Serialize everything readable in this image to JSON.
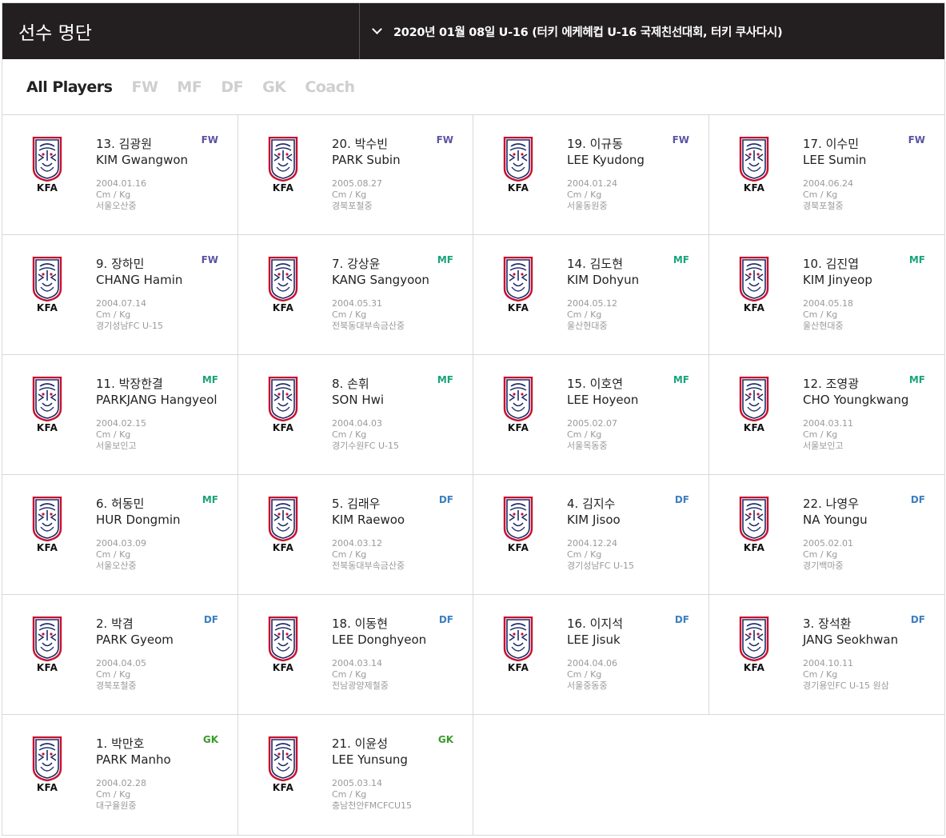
{
  "header": {
    "title": "선수 명단",
    "selector": "2020년 01월 08일 U-16 (터키 에케헤컵 U-16 국제친선대회, 터키 쿠사다시)"
  },
  "filters": [
    "All Players",
    "FW",
    "MF",
    "DF",
    "GK",
    "Coach"
  ],
  "active_filter": "All Players",
  "logo_text": "KFA",
  "position_colors": {
    "FW": "#5b54a3",
    "MF": "#1aa47a",
    "DF": "#3d7fc0",
    "GK": "#3a9a2a"
  },
  "players": [
    {
      "kname": "13. 김광원",
      "ename": "KIM Gwangwon",
      "pos": "FW",
      "birth": "2004.01.16",
      "size": "Cm / Kg",
      "team": "서울오산중"
    },
    {
      "kname": "20. 박수빈",
      "ename": "PARK Subin",
      "pos": "FW",
      "birth": "2005.08.27",
      "size": "Cm / Kg",
      "team": "경북포철중"
    },
    {
      "kname": "19. 이규동",
      "ename": "LEE Kyudong",
      "pos": "FW",
      "birth": "2004.01.24",
      "size": "Cm / Kg",
      "team": "서울동원중"
    },
    {
      "kname": "17. 이수민",
      "ename": "LEE Sumin",
      "pos": "FW",
      "birth": "2004.06.24",
      "size": "Cm / Kg",
      "team": "경북포철중"
    },
    {
      "kname": "9. 장하민",
      "ename": "CHANG Hamin",
      "pos": "FW",
      "birth": "2004.07.14",
      "size": "Cm / Kg",
      "team": "경기성남FC U-15"
    },
    {
      "kname": "7. 강상윤",
      "ename": "KANG Sangyoon",
      "pos": "MF",
      "birth": "2004.05.31",
      "size": "Cm / Kg",
      "team": "전북동대부속금산중"
    },
    {
      "kname": "14. 김도현",
      "ename": "KIM Dohyun",
      "pos": "MF",
      "birth": "2004.05.12",
      "size": "Cm / Kg",
      "team": "울산현대중"
    },
    {
      "kname": "10. 김진엽",
      "ename": "KIM Jinyeop",
      "pos": "MF",
      "birth": "2004.05.18",
      "size": "Cm / Kg",
      "team": "울산현대중"
    },
    {
      "kname": "11. 박장한결",
      "ename": "PARKJANG Hangyeol",
      "pos": "MF",
      "birth": "2004.02.15",
      "size": "Cm / Kg",
      "team": "서울보인고"
    },
    {
      "kname": "8. 손휘",
      "ename": "SON Hwi",
      "pos": "MF",
      "birth": "2004.04.03",
      "size": "Cm / Kg",
      "team": "경기수원FC U-15"
    },
    {
      "kname": "15. 이호연",
      "ename": "LEE Hoyeon",
      "pos": "MF",
      "birth": "2005.02.07",
      "size": "Cm / Kg",
      "team": "서울목동중"
    },
    {
      "kname": "12. 조영광",
      "ename": "CHO Youngkwang",
      "pos": "MF",
      "birth": "2004.03.11",
      "size": "Cm / Kg",
      "team": "서울보인고"
    },
    {
      "kname": "6. 허동민",
      "ename": "HUR Dongmin",
      "pos": "MF",
      "birth": "2004.03.09",
      "size": "Cm / Kg",
      "team": "서울오산중"
    },
    {
      "kname": "5. 김래우",
      "ename": "KIM Raewoo",
      "pos": "DF",
      "birth": "2004.03.12",
      "size": "Cm / Kg",
      "team": "전북동대부속금산중"
    },
    {
      "kname": "4. 김지수",
      "ename": "KIM Jisoo",
      "pos": "DF",
      "birth": "2004.12.24",
      "size": "Cm / Kg",
      "team": "경기성남FC U-15"
    },
    {
      "kname": "22. 나영우",
      "ename": "NA Youngu",
      "pos": "DF",
      "birth": "2005.02.01",
      "size": "Cm / Kg",
      "team": "경기백마중"
    },
    {
      "kname": "2. 박겸",
      "ename": "PARK Gyeom",
      "pos": "DF",
      "birth": "2004.04.05",
      "size": "Cm / Kg",
      "team": "경북포철중"
    },
    {
      "kname": "18. 이동현",
      "ename": "LEE Donghyeon",
      "pos": "DF",
      "birth": "2004.03.14",
      "size": "Cm / Kg",
      "team": "전남광양제철중"
    },
    {
      "kname": "16. 이지석",
      "ename": "LEE Jisuk",
      "pos": "DF",
      "birth": "2004.04.06",
      "size": "Cm / Kg",
      "team": "서울중동중"
    },
    {
      "kname": "3. 장석환",
      "ename": "JANG Seokhwan",
      "pos": "DF",
      "birth": "2004.10.11",
      "size": "Cm / Kg",
      "team": "경기용인FC U-15 원삼"
    },
    {
      "kname": "1. 박만호",
      "ename": "PARK Manho",
      "pos": "GK",
      "birth": "2004.02.28",
      "size": "Cm / Kg",
      "team": "대구율원중"
    },
    {
      "kname": "21. 이윤성",
      "ename": "LEE Yunsung",
      "pos": "GK",
      "birth": "2005.03.14",
      "size": "Cm / Kg",
      "team": "충남천안FMCFCU15"
    }
  ]
}
